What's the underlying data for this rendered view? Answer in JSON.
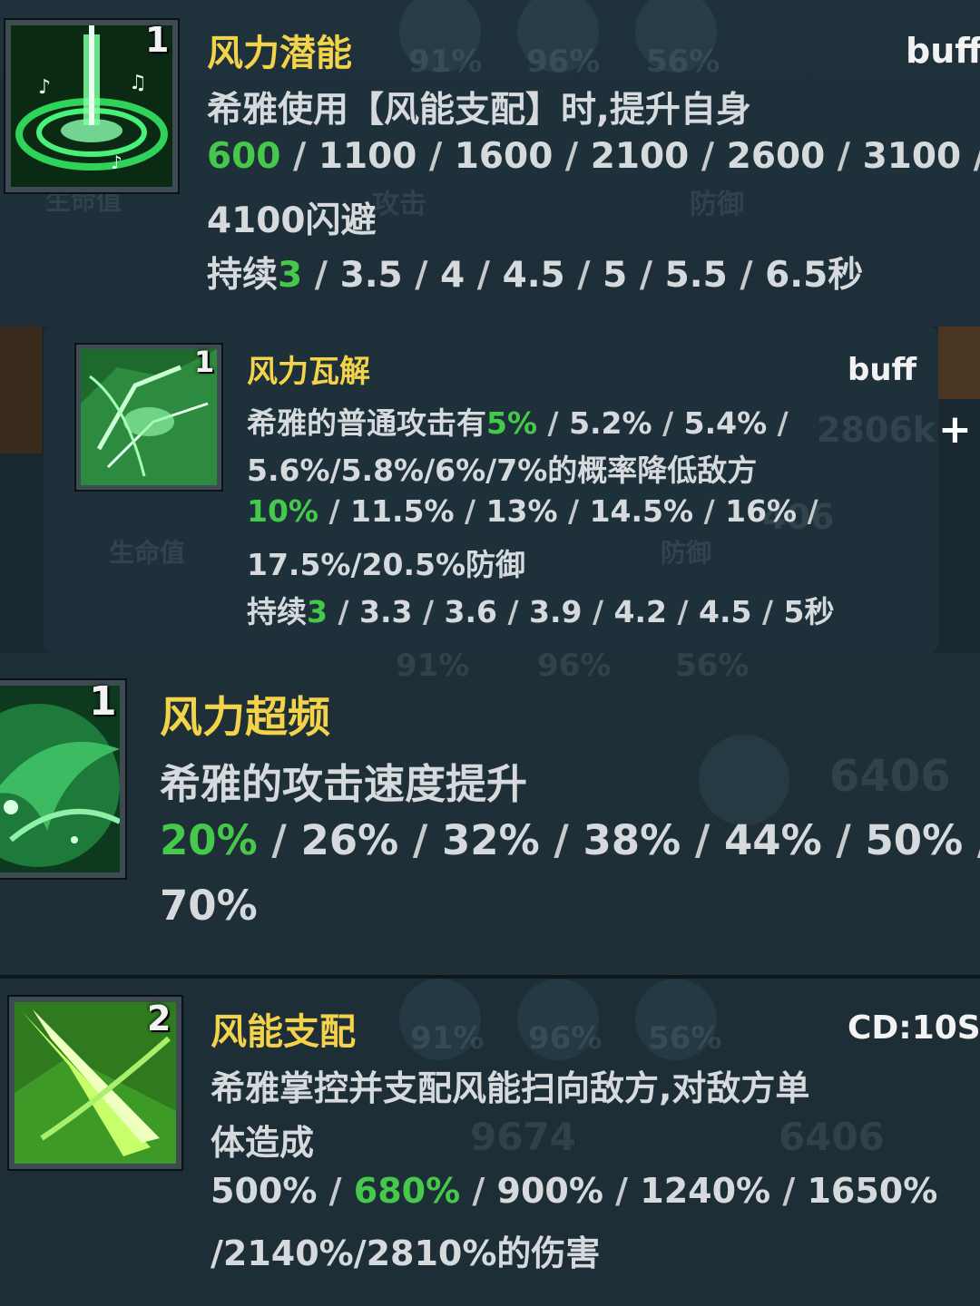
{
  "skills": [
    {
      "name": "风力潜能",
      "level": "1",
      "tag": "buff",
      "lines": [
        "希雅使用【风能支配】时,提升自身",
        "600/1100/1600/2100/2600/3100/",
        "4100闪避",
        "持续3/3.5/4/4.5/5/5.5/6.5秒"
      ],
      "icon": "wind-vortex-icon"
    },
    {
      "name": "风力瓦解",
      "level": "1",
      "tag": "buff",
      "lines": [
        "希雅的普通攻击有5%/5.2%/5.4%/",
        "5.6%/5.8%/6%/7%的概率降低敌方",
        "10%/11.5%/13%/14.5%/16%/",
        "17.5%/20.5%防御",
        "持续3/3.3/3.6/3.9/4.2/4.5/5秒"
      ],
      "icon": "wind-break-icon"
    },
    {
      "name": "风力超频",
      "level": "1",
      "tag": "",
      "lines": [
        "希雅的攻击速度提升",
        "20%/26%/32%/38%/44%/50%/",
        "70%"
      ],
      "icon": "wind-wave-icon"
    },
    {
      "name": "风能支配",
      "level": "2",
      "tag": "CD:10S",
      "lines": [
        "希雅掌控并支配风能扫向敌方,对敌方单",
        "体造成",
        "500%/680%/900%/1240%/1650%",
        "/2140%/2810%的伤害"
      ],
      "icon": "wind-blade-icon"
    }
  ],
  "background": {
    "stat_percents": [
      "91%",
      "96%",
      "56%"
    ],
    "hp_label": "生命值",
    "atk_label": "攻击",
    "def_label": "防御",
    "vals": [
      "2806k",
      "406",
      "6406",
      "9674",
      "6406"
    ]
  },
  "colors": {
    "title": "#f3d34a",
    "highlight": "#46c94a",
    "text": "#d6dadd"
  }
}
